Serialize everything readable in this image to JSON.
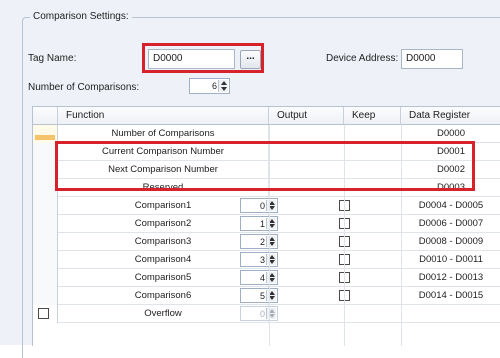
{
  "settings": {
    "group_title": "Comparison Settings:",
    "tag_name_label": "Tag Name:",
    "tag_name_value": "D0000",
    "tag_name_button": "...",
    "device_address_label": "Device Address:",
    "device_address_value": "D0000",
    "num_comparisons_label": "Number of Comparisons:",
    "num_comparisons_value": "6"
  },
  "table": {
    "headers": [
      "Function",
      "Output",
      "Keep",
      "Data Register"
    ],
    "rows": [
      {
        "function": "Number of Comparisons",
        "output": "",
        "keep": "",
        "register": "D0000"
      },
      {
        "function": "Current Comparison Number",
        "output": "",
        "keep": "",
        "register": "D0001"
      },
      {
        "function": "Next Comparison Number",
        "output": "",
        "keep": "",
        "register": "D0002"
      },
      {
        "function": "Reserved",
        "output": "",
        "keep": "",
        "register": "D0003"
      },
      {
        "function": "Comparison1",
        "output": "0",
        "keep": "unchecked",
        "register": "D0004 - D0005"
      },
      {
        "function": "Comparison2",
        "output": "1",
        "keep": "unchecked",
        "register": "D0006 - D0007"
      },
      {
        "function": "Comparison3",
        "output": "2",
        "keep": "unchecked",
        "register": "D0008 - D0009"
      },
      {
        "function": "Comparison4",
        "output": "3",
        "keep": "unchecked",
        "register": "D0010 - D0011"
      },
      {
        "function": "Comparison5",
        "output": "4",
        "keep": "unchecked",
        "register": "D0012 - D0013"
      },
      {
        "function": "Comparison6",
        "output": "5",
        "keep": "unchecked",
        "register": "D0014 - D0015"
      },
      {
        "function": "Overflow",
        "output": "0",
        "keep": "",
        "register": ""
      }
    ]
  },
  "colors": {
    "highlight": "#d7222b",
    "selected_row_marker": "#f6c36b"
  }
}
